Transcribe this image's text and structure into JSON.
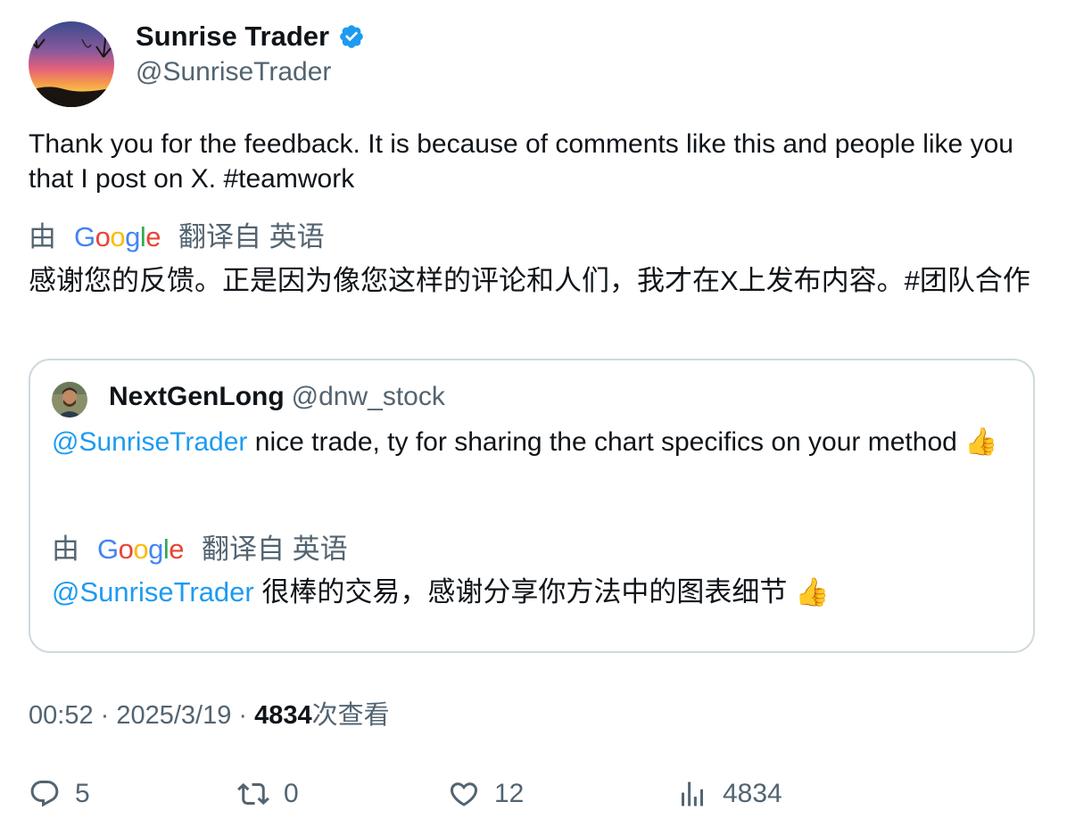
{
  "author": {
    "name": "Sunrise Trader",
    "handle": "@SunriseTrader"
  },
  "tweet": {
    "text_main": "Thank you for the feedback.  It is because of comments like this and people like you that I post on X.  ",
    "hashtag": "#teamwork",
    "translation": {
      "prefix": "由",
      "provider": "Google",
      "suffix": "翻译自 英语",
      "text": "感谢您的反馈。正是因为像您这样的评论和人们，我才在X上发布内容。#团队合作"
    }
  },
  "quoted": {
    "name": "NextGenLong",
    "handle": "@dnw_stock",
    "mention": "@SunriseTrader",
    "text": " nice trade, ty for sharing the chart specifics on your method 👍",
    "translation": {
      "prefix": "由",
      "provider": "Google",
      "suffix": "翻译自 英语",
      "mention": "@SunriseTrader",
      "text": " 很棒的交易，感谢分享你方法中的图表细节 👍"
    }
  },
  "meta": {
    "time": "00:52",
    "sep1": " · ",
    "date": "2025/3/19",
    "sep2": " · ",
    "views": "4834",
    "views_label": "次查看"
  },
  "actions": {
    "replies": "5",
    "reposts": "0",
    "likes": "12",
    "views": "4834"
  },
  "colors": {
    "link": "#1d9bf0",
    "verified": "#1d9bf0",
    "secondary": "#536471",
    "border": "#cfd9de"
  }
}
